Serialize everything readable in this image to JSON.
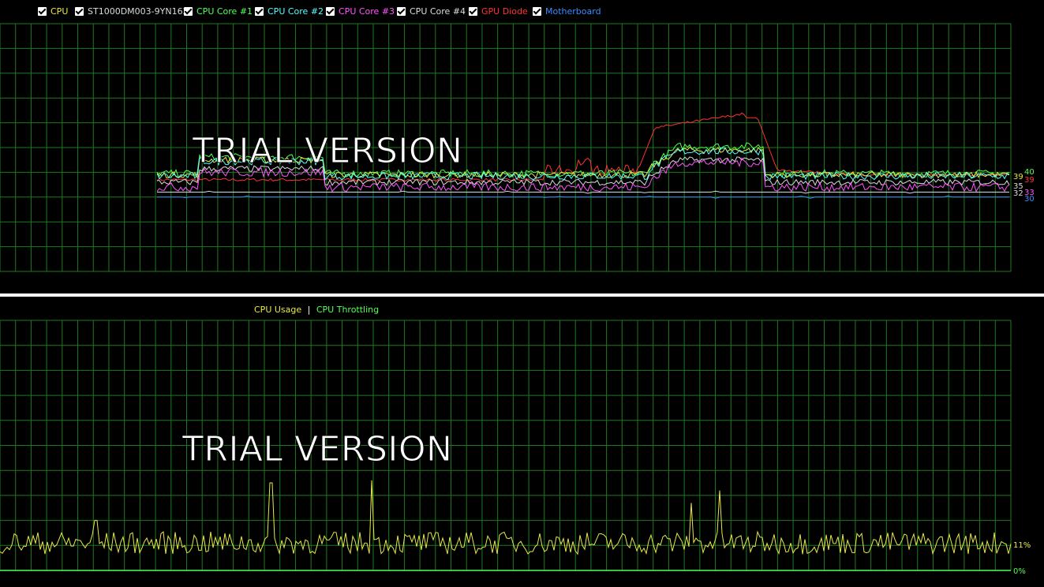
{
  "top_chart": {
    "legend": [
      {
        "label": "CPU",
        "color": "#e8e84a",
        "checked": true
      },
      {
        "label": "ST1000DM003-9YN162",
        "color": "#dcdcdc",
        "checked": true
      },
      {
        "label": "CPU Core #1",
        "color": "#55ff55",
        "checked": true
      },
      {
        "label": "CPU Core #2",
        "color": "#55ffff",
        "checked": true
      },
      {
        "label": "CPU Core #3",
        "color": "#ff55ff",
        "checked": true
      },
      {
        "label": "CPU Core #4",
        "color": "#dcdcdc",
        "checked": true
      },
      {
        "label": "GPU Diode",
        "color": "#ff3333",
        "checked": true
      },
      {
        "label": "Motherboard",
        "color": "#3a8dff",
        "checked": true
      }
    ],
    "watermark": "TRIAL VERSION",
    "end_labels": [
      {
        "text": "40",
        "color": "#55ff55"
      },
      {
        "text": "39",
        "color": "#e8e84a"
      },
      {
        "text": "39",
        "color": "#ff3333"
      },
      {
        "text": "35",
        "color": "#dcdcdc"
      },
      {
        "text": "33",
        "color": "#ff55ff"
      },
      {
        "text": "32",
        "color": "#dcdcdc"
      },
      {
        "text": "30",
        "color": "#3a8dff"
      }
    ]
  },
  "bottom_chart": {
    "legend_usage": "CPU Usage",
    "legend_separator": "|",
    "legend_throttling": "CPU Throttling",
    "usage_color": "#e8e84a",
    "throttling_color": "#55ff55",
    "watermark": "TRIAL VERSION",
    "current_label": "11%",
    "zero_label": "0%"
  },
  "chart_data": [
    {
      "type": "line",
      "ylim": [
        0,
        100
      ],
      "grid": true,
      "series": [
        {
          "name": "CPU",
          "color": "#e8e84a",
          "current": 39
        },
        {
          "name": "ST1000DM003-9YN162",
          "color": "#dcdcdc",
          "current": 32
        },
        {
          "name": "CPU Core #1",
          "color": "#55ff55",
          "current": 40
        },
        {
          "name": "CPU Core #2",
          "color": "#55ffff",
          "current": 39
        },
        {
          "name": "CPU Core #3",
          "color": "#ff55ff",
          "current": 33
        },
        {
          "name": "CPU Core #4",
          "color": "#dcdcdc",
          "current": 35
        },
        {
          "name": "GPU Diode",
          "color": "#ff3333",
          "current": 39
        },
        {
          "name": "Motherboard",
          "color": "#3a8dff",
          "current": 30
        }
      ]
    },
    {
      "type": "line",
      "ylim": [
        0,
        100
      ],
      "grid": true,
      "series": [
        {
          "name": "CPU Usage",
          "color": "#e8e84a",
          "current": 11
        },
        {
          "name": "CPU Throttling",
          "color": "#55ff55",
          "current": 0
        }
      ]
    }
  ]
}
